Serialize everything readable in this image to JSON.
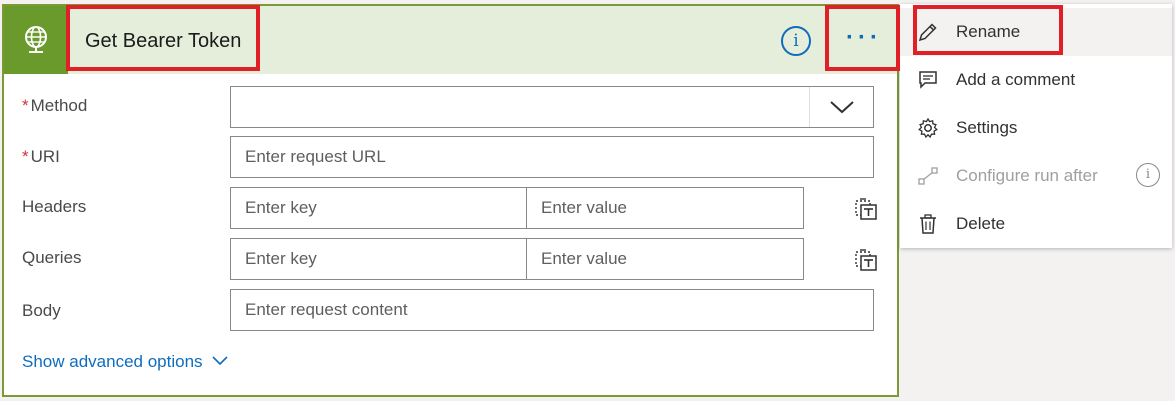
{
  "action": {
    "title": "Get Bearer Token",
    "info_glyph": "i",
    "more_glyph": "···"
  },
  "fields": {
    "method": {
      "label": "Method",
      "required_mark": "*",
      "value": ""
    },
    "uri": {
      "label": "URI",
      "required_mark": "*",
      "placeholder": "Enter request URL"
    },
    "headers": {
      "label": "Headers",
      "key_placeholder": "Enter key",
      "value_placeholder": "Enter value"
    },
    "queries": {
      "label": "Queries",
      "key_placeholder": "Enter key",
      "value_placeholder": "Enter value"
    },
    "body": {
      "label": "Body",
      "placeholder": "Enter request content"
    }
  },
  "advanced_label": "Show advanced options",
  "menu": {
    "items": [
      {
        "label": "Rename",
        "icon": "pencil-icon"
      },
      {
        "label": "Add a comment",
        "icon": "comment-icon"
      },
      {
        "label": "Settings",
        "icon": "gear-icon"
      },
      {
        "label": "Configure run after",
        "icon": "run-after-icon",
        "disabled": true
      },
      {
        "label": "Delete",
        "icon": "trash-icon"
      }
    ],
    "info_glyph": "i"
  },
  "colors": {
    "header_bg": "#e5eedb",
    "icon_bg": "#6a9a2c",
    "card_border": "#7a9a37",
    "accent": "#0f6cbd",
    "highlight": "#e01f26",
    "required": "#d13438"
  }
}
